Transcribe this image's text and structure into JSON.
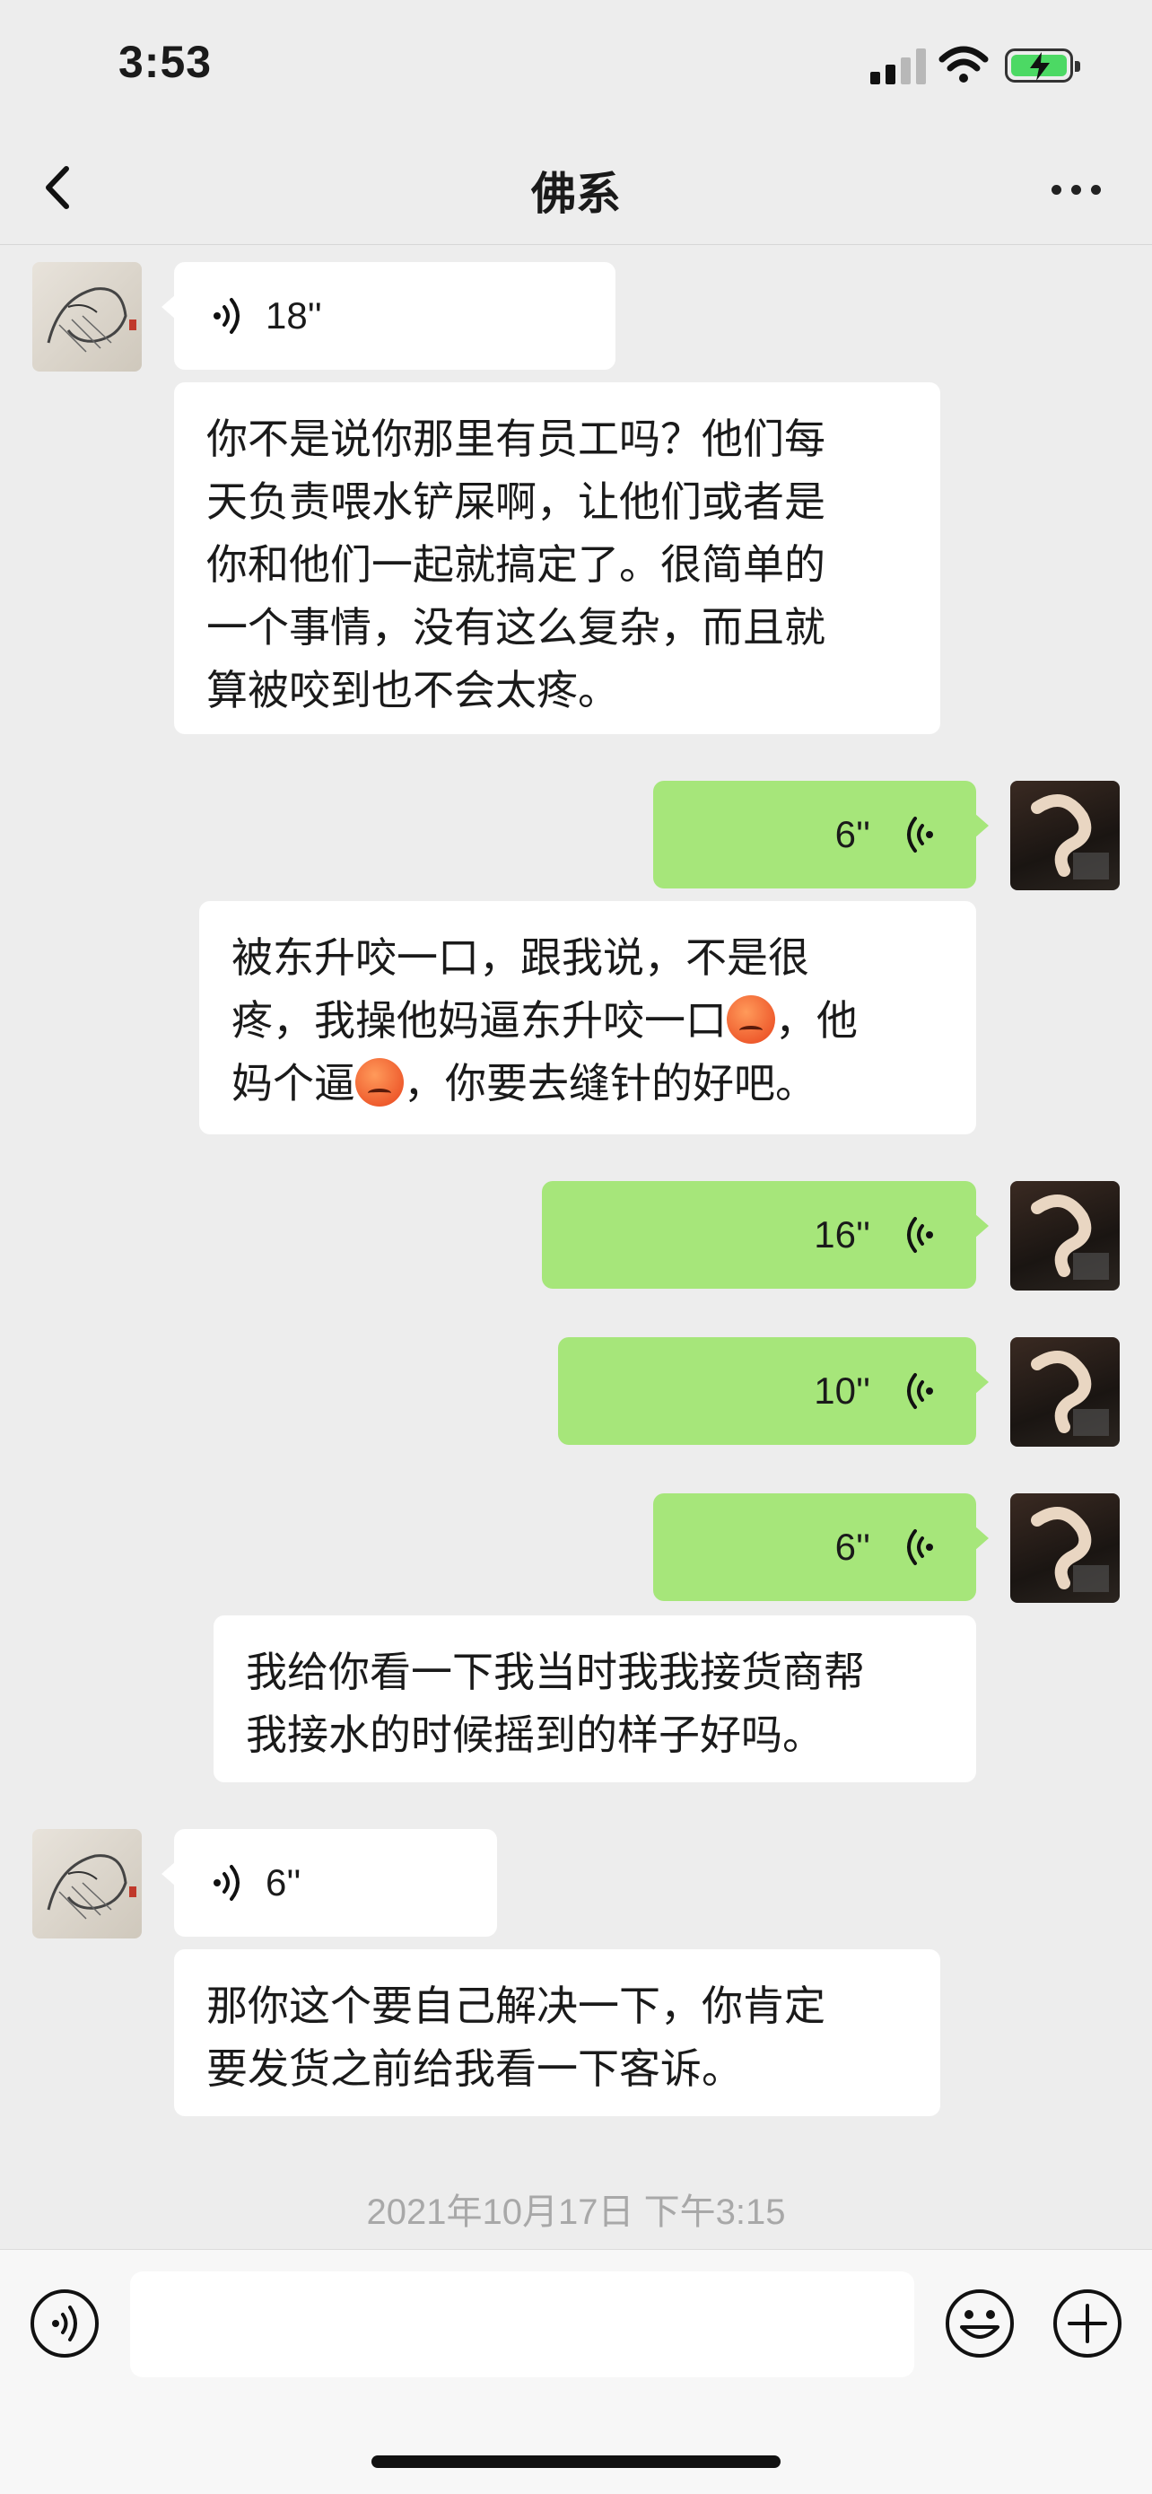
{
  "status_bar": {
    "time": "3:53"
  },
  "nav": {
    "title": "佛系"
  },
  "messages": [
    {
      "type": "voice",
      "side": "in",
      "duration": "18''"
    },
    {
      "type": "text",
      "side": "in",
      "lines": [
        "你不是说你那里有员工吗？他们每",
        "天负责喂水铲屎啊，让他们或者是",
        "你和他们一起就搞定了。很简单的",
        "一个事情，没有这么复杂，而且就",
        "算被咬到也不会太疼。"
      ]
    },
    {
      "type": "voice",
      "side": "out",
      "duration": "6''"
    },
    {
      "type": "text",
      "side": "out",
      "line1": "被东升咬一口，跟我说，不是很",
      "line2a": "疼，我操他妈逼东升咬一口",
      "line2b": "，他",
      "line3a": "妈个逼",
      "line3b": "，你要去缝针的好吧。",
      "emoji": "pouting-face"
    },
    {
      "type": "voice",
      "side": "out",
      "duration": "16''"
    },
    {
      "type": "voice",
      "side": "out",
      "duration": "10''"
    },
    {
      "type": "voice",
      "side": "out",
      "duration": "6''"
    },
    {
      "type": "text",
      "side": "out",
      "lines": [
        "我给你看一下我当时我我接货商帮",
        "我接水的时候摇到的样子好吗。"
      ]
    },
    {
      "type": "voice",
      "side": "in",
      "duration": "6''"
    },
    {
      "type": "text",
      "side": "in",
      "lines": [
        "那你这个要自己解决一下，你肯定",
        "要发货之前给我看一下客诉。"
      ]
    }
  ],
  "timestamp": "2021年10月17日 下午3:15",
  "input": {
    "value": "",
    "placeholder": ""
  },
  "colors": {
    "background": "#ededed",
    "outgoing_bubble": "#a6e67a",
    "incoming_bubble": "#ffffff",
    "timestamp": "#a8a8a8"
  },
  "icons": [
    "back-icon",
    "more-icon",
    "voice-wave-icon",
    "voice-input-icon",
    "emoji-icon",
    "plus-icon"
  ]
}
